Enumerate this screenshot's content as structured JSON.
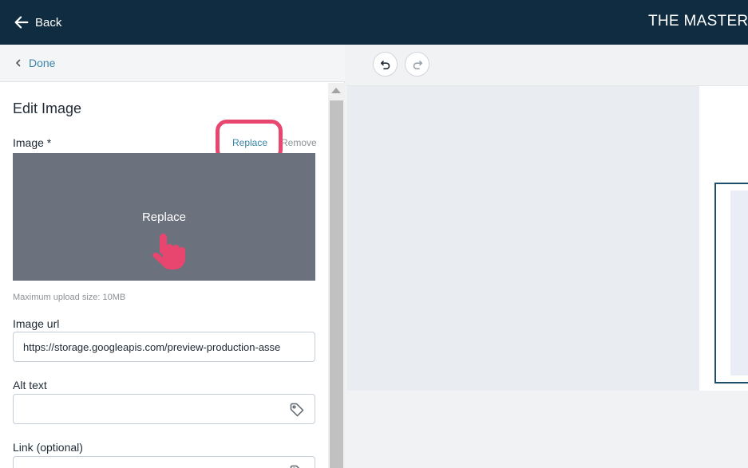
{
  "topbar": {
    "back_label": "Back",
    "app_title": "THE MASTER T"
  },
  "panel": {
    "done_label": "Done",
    "heading": "Edit Image",
    "image_label": "Image *",
    "replace_link": "Replace",
    "remove_link": "Remove",
    "preview_text": "Replace",
    "upload_hint": "Maximum upload size: 10MB",
    "image_url_label": "Image url",
    "image_url_value": "https://storage.googleapis.com/preview-production-asse",
    "alt_text_label": "Alt text",
    "alt_text_value": "",
    "link_label": "Link (optional)",
    "link_value": ""
  },
  "colors": {
    "topbar_bg": "#0f2c40",
    "accent_link": "#3b84a8",
    "highlight": "#e8466e",
    "preview_bg": "#6c727d"
  },
  "icons": [
    "arrow-left-icon",
    "chevron-left-icon",
    "undo-icon",
    "redo-icon",
    "tag-icon",
    "pointing-hand-icon"
  ]
}
